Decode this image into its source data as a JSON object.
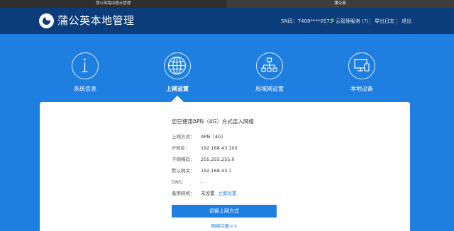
{
  "browser": {
    "tabs": [
      {
        "label": "蒲公英路由器云管理"
      },
      {
        "label": "蒲公英"
      }
    ]
  },
  "header": {
    "brand": "蒲公英本地管理",
    "sn": "SN码：7408****0973",
    "cloud_service": "云管理服务 (?)",
    "export_log": "导出日志",
    "logout": "退出",
    "colors": {
      "header_bg": "#0b3d7a",
      "status_ok": "#35c24a"
    }
  },
  "nav": {
    "items": [
      {
        "label": "系统信息",
        "icon": "info-icon"
      },
      {
        "label": "上网设置",
        "icon": "globe-icon",
        "active": true
      },
      {
        "label": "局域网设置",
        "icon": "lan-topology-icon"
      },
      {
        "label": "本地设备",
        "icon": "devices-icon"
      }
    ]
  },
  "connection": {
    "title": "您已使用APN（4G）方式连入网络",
    "rows": [
      {
        "label": "上网方式：",
        "value": "APN（4G）"
      },
      {
        "label": "IP地址：",
        "value": "192.168.43.100"
      },
      {
        "label": "子网掩码：",
        "value": "255.255.255.0"
      },
      {
        "label": "默认网关：",
        "value": "192.168.43.1"
      },
      {
        "label": "DNS：",
        "value": "-"
      },
      {
        "label": "备用网络：",
        "value": "未设置",
        "link": "立即设置"
      }
    ],
    "switch_button": "切换上网方式",
    "diagnose_link": "网络诊断>>"
  },
  "colors": {
    "page_bg": "#1f7fe0",
    "accent": "#1f7fe0"
  }
}
